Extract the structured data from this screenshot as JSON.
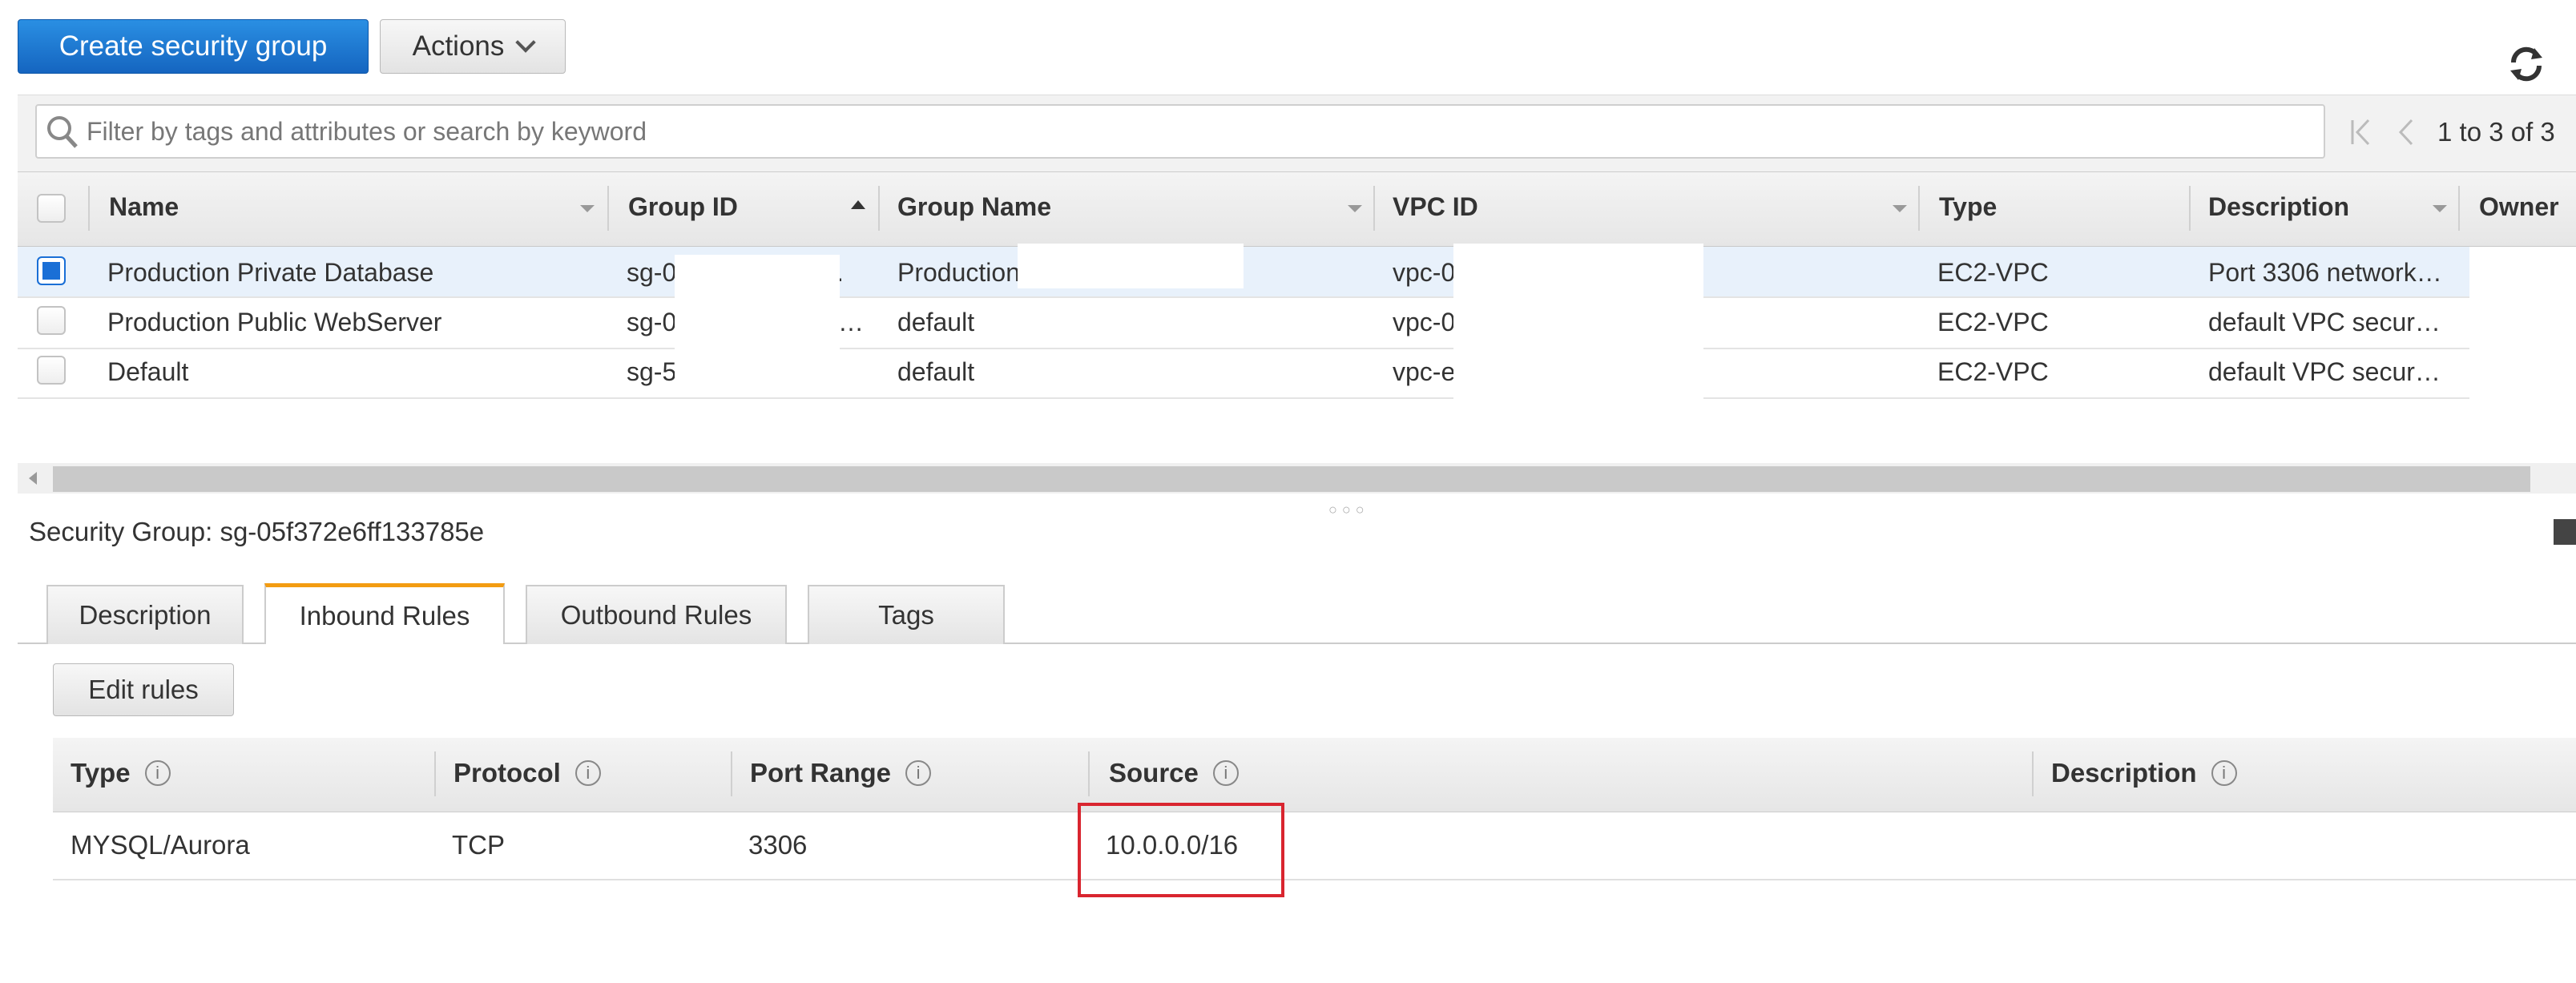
{
  "toolbar": {
    "create_label": "Create security group",
    "actions_label": "Actions"
  },
  "filter": {
    "placeholder": "Filter by tags and attributes or search by keyword",
    "pager": "1 to 3 of 3"
  },
  "table": {
    "headers": [
      "Name",
      "Group ID",
      "Group Name",
      "VPC ID",
      "Type",
      "Description",
      "Owner"
    ],
    "rows": [
      {
        "selected": true,
        "name": "Production Private Database",
        "group_id": "sg-0",
        "group_id_tail": ".",
        "group_name": "Production",
        "vpc_id": "vpc-0",
        "type": "EC2-VPC",
        "description": "Port 3306 network…"
      },
      {
        "selected": false,
        "name": "Production Public WebServer",
        "group_id": "sg-0",
        "group_id_tail": "…",
        "group_name": "default",
        "vpc_id": "vpc-0",
        "type": "EC2-VPC",
        "description": "default VPC secur…"
      },
      {
        "selected": false,
        "name": "Default",
        "group_id": "sg-5",
        "group_id_tail": "",
        "group_name": "default",
        "vpc_id": "vpc-e",
        "type": "EC2-VPC",
        "description": "default VPC secur…"
      }
    ]
  },
  "details": {
    "label": "Security Group:",
    "group_id": "sg-05f372e6ff133785e",
    "tabs": [
      "Description",
      "Inbound Rules",
      "Outbound Rules",
      "Tags"
    ],
    "active_tab": "Inbound Rules",
    "edit_label": "Edit rules",
    "rule_headers": [
      "Type",
      "Protocol",
      "Port Range",
      "Source",
      "Description"
    ],
    "rules": [
      {
        "type": "MYSQL/Aurora",
        "protocol": "TCP",
        "port_range": "3306",
        "source": "10.0.0.0/16",
        "description": ""
      }
    ]
  },
  "icons": {
    "refresh": "refresh-icon",
    "search": "search-icon",
    "info": "info-icon",
    "first_page": "first-page-icon",
    "prev_page": "prev-page-icon",
    "dock": "dock-panel-icon"
  },
  "colors": {
    "primary": "#1565c0",
    "active_tab_accent": "#f39c12",
    "highlight_border": "#d9252f",
    "selected_row": "#e8f1fb"
  }
}
